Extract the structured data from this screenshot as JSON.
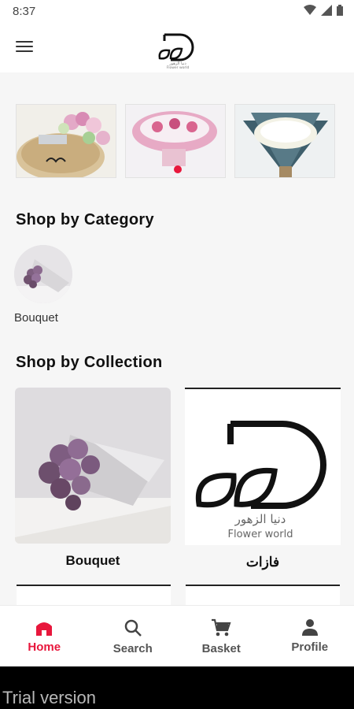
{
  "status_bar": {
    "time": "8:37"
  },
  "app": {
    "logo_arabic": "دنيا الزهور",
    "logo_english": "Flower world"
  },
  "banners": [
    {
      "name": "tray-arrangement"
    },
    {
      "name": "pink-white-basket"
    },
    {
      "name": "white-bouquet-teal-wrap"
    }
  ],
  "categories": {
    "title": "Shop by Category",
    "items": [
      {
        "label": "Bouquet"
      }
    ]
  },
  "collections": {
    "title": "Shop by Collection",
    "items": [
      {
        "label": "Bouquet"
      },
      {
        "label": "فازات"
      }
    ]
  },
  "bottom_nav": {
    "items": [
      {
        "label": "Home",
        "icon": "home-icon",
        "active": true
      },
      {
        "label": "Search",
        "icon": "search-icon",
        "active": false
      },
      {
        "label": "Basket",
        "icon": "cart-icon",
        "active": false
      },
      {
        "label": "Profile",
        "icon": "person-icon",
        "active": false
      }
    ]
  },
  "watermark": "Trial version",
  "colors": {
    "accent": "#e8173c",
    "background": "#f6f6f6"
  }
}
